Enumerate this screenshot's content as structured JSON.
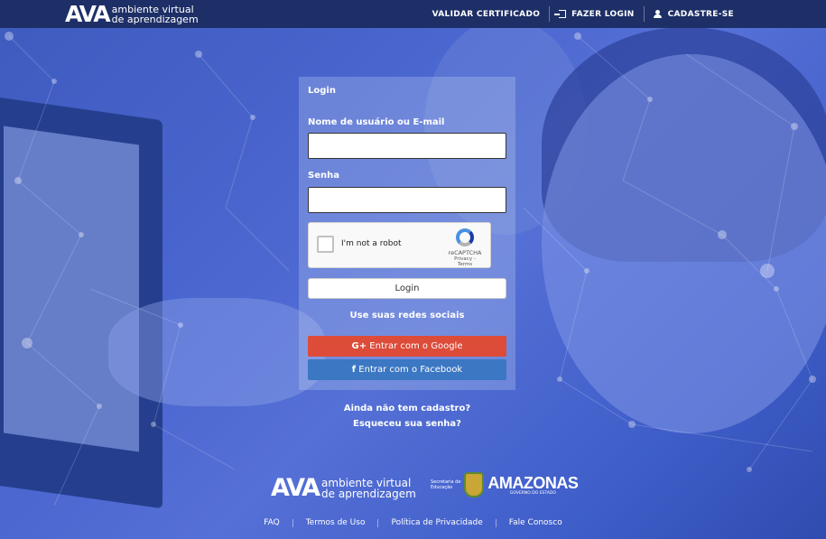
{
  "header": {
    "brand_mark": "AVA",
    "brand_line1": "ambiente virtual",
    "brand_line2": "de aprendizagem",
    "nav": {
      "validar": "VALIDAR CERTIFICADO",
      "login": "FAZER LOGIN",
      "cadastro": "CADASTRE-SE"
    }
  },
  "form": {
    "title": "Login",
    "username_label": "Nome de usuário ou E-mail",
    "username_value": "",
    "password_label": "Senha",
    "password_value": "",
    "captcha_text": "I'm not a robot",
    "captcha_brand": "reCAPTCHA",
    "captcha_links": "Privacy - Terms",
    "login_button": "Login",
    "social_title": "Use suas redes sociais",
    "google_button": "Entrar com o Google",
    "google_icon_glyph": "G+",
    "facebook_button": "Entrar com o Facebook",
    "facebook_icon_glyph": "f"
  },
  "links": {
    "register": "Ainda não tem cadastro?",
    "forgot": "Esqueceu sua senha?"
  },
  "footer_brand": {
    "mark": "AVA",
    "line1": "ambiente virtual",
    "line2": "de aprendizagem",
    "sec_line1": "Secretaria de",
    "sec_line2": "Educação",
    "state": "AMAZONAS",
    "state_sub": "GOVERNO DO ESTADO"
  },
  "footer_links": [
    "FAQ",
    "Termos de Uso",
    "Política de Privacidade",
    "Fale Conosco"
  ],
  "colors": {
    "header_bg": "#1d2f66",
    "google": "#dd4b39",
    "facebook": "#3b77c3",
    "overlay": "#4a66cf"
  }
}
